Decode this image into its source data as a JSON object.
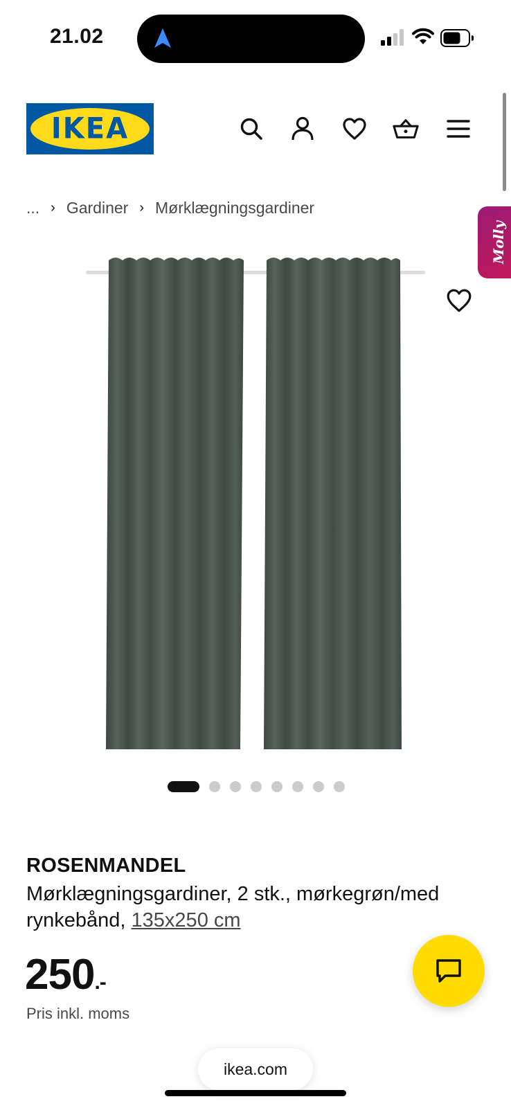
{
  "status_bar": {
    "time": "21.02"
  },
  "header": {
    "logo_text": "IKEA",
    "icons": [
      "search-icon",
      "account-icon",
      "heart-icon",
      "basket-icon",
      "menu-icon"
    ]
  },
  "breadcrumb": {
    "ellipsis": "...",
    "items": [
      "Gardiner",
      "Mørklægningsgardiner"
    ]
  },
  "molly": {
    "label": "Molly"
  },
  "carousel": {
    "total": 8,
    "active_index": 0
  },
  "product": {
    "brand": "ROSENMANDEL",
    "description": "Mørklægningsgardiner, 2 stk., mørkegrøn/med rynkebånd, ",
    "size": "135x250 cm",
    "price": "250",
    "price_suffix": ".-",
    "price_note": "Pris inkl. moms",
    "curtain_color": "#4a554e"
  },
  "browser": {
    "url": "ikea.com"
  },
  "colors": {
    "ikea_blue": "#0058a3",
    "ikea_yellow": "#ffda1a",
    "chat_yellow": "#ffdb00",
    "molly_magenta": "#b0196b"
  }
}
